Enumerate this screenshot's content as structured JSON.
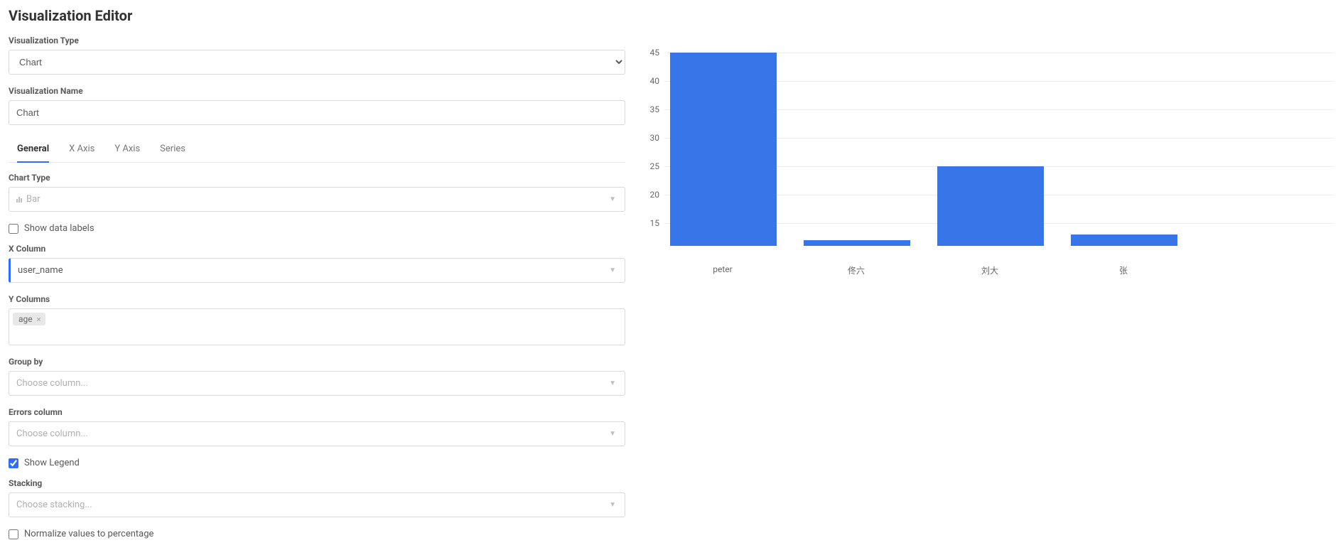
{
  "page": {
    "title": "Visualization Editor"
  },
  "form": {
    "viz_type_label": "Visualization Type",
    "viz_type_value": "Chart",
    "viz_name_label": "Visualization Name",
    "viz_name_value": "Chart"
  },
  "tabs": {
    "general": "General",
    "x_axis": "X Axis",
    "y_axis": "Y Axis",
    "series": "Series"
  },
  "general": {
    "chart_type_label": "Chart Type",
    "chart_type_value": "Bar",
    "show_data_labels_label": "Show data labels",
    "show_data_labels_checked": false,
    "x_column_label": "X Column",
    "x_column_value": "user_name",
    "y_columns_label": "Y Columns",
    "y_columns_tags": [
      "age"
    ],
    "group_by_label": "Group by",
    "group_by_placeholder": "Choose column...",
    "errors_column_label": "Errors column",
    "errors_column_placeholder": "Choose column...",
    "show_legend_label": "Show Legend",
    "show_legend_checked": true,
    "stacking_label": "Stacking",
    "stacking_placeholder": "Choose stacking...",
    "normalize_label": "Normalize values to percentage",
    "normalize_checked": false
  },
  "chart_data": {
    "type": "bar",
    "categories": [
      "peter",
      "佟六",
      "刘大",
      "张"
    ],
    "values": [
      45,
      12,
      25,
      13
    ],
    "y_ticks": [
      15,
      20,
      25,
      30,
      35,
      40,
      45
    ],
    "ylim": [
      11,
      46
    ],
    "color": "#3875E9"
  }
}
